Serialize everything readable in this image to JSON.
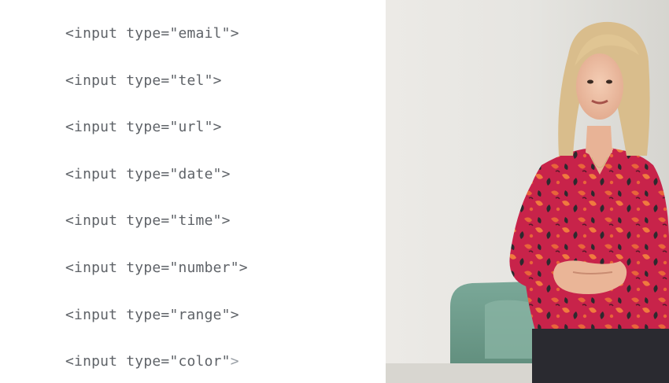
{
  "code_lines": [
    {
      "prefix": "<input type=\"email\"",
      "suffix": ">"
    },
    {
      "prefix": "<input type=\"tel\"",
      "suffix": ">"
    },
    {
      "prefix": "<input type=\"url\"",
      "suffix": ">"
    },
    {
      "prefix": "<input type=\"date\"",
      "suffix": ">"
    },
    {
      "prefix": "<input type=\"time\"",
      "suffix": ">"
    },
    {
      "prefix": "<input type=\"number\"",
      "suffix": ">"
    },
    {
      "prefix": "<input type=\"range\"",
      "suffix": ">"
    },
    {
      "prefix": "<input type=\"color\"",
      "suffix": ">"
    }
  ],
  "colors": {
    "code_text": "#5f6368",
    "wall": "#e5e4e0",
    "armchair": "#6f9e8c",
    "blouse": "#c8234a",
    "hair": "#d9bd8c"
  }
}
